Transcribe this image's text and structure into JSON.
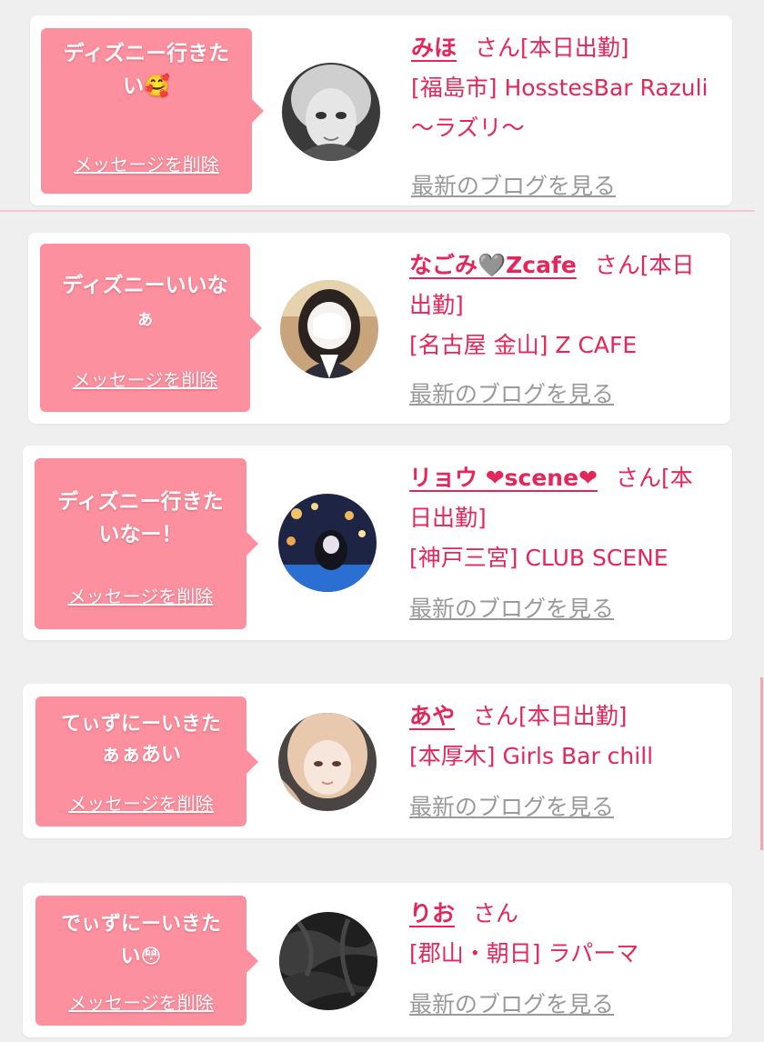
{
  "delete_label": "メッセージを削除",
  "blog_label": "最新のブログを見る",
  "san_label": "さん",
  "cards": [
    {
      "message_line1": "ディズニー行きた",
      "message_line2": "い🥰",
      "name": "みほ",
      "status": "[本日出勤]",
      "shop_line1": "[福島市] HosstesBar Razuli",
      "shop_line2": "〜ラズリ〜",
      "avatar_icon": "avatar-grayscale-girl"
    },
    {
      "message_line1": "ディズニーいいな",
      "message_line2": "ぁ",
      "name": "なごみ🩶Zcafe",
      "status_line1": "[本日",
      "status_line2": "出勤]",
      "shop_line1": "[名古屋 金山] Z CAFE",
      "avatar_icon": "avatar-uniform-girl"
    },
    {
      "message_line1": "ディズニー行きた",
      "message_line2": "いなー！",
      "name": "リョウ ❤scene❤",
      "status_line1": "[本",
      "status_line2": "日出勤]",
      "shop_line1": "[神戸三宮] CLUB SCENE",
      "avatar_icon": "avatar-night-lights"
    },
    {
      "message_line1": "てぃずにーいきた",
      "message_line2": "ぁぁあい",
      "name": "あや",
      "status": "[本日出勤]",
      "shop_line1": "[本厚木] Girls Bar chill",
      "avatar_icon": "avatar-blonde-girl"
    },
    {
      "message_line1": "でぃずにーいきた",
      "message_line2": "い😳",
      "name": "りお",
      "status": "",
      "shop_line1": "[郡山・朝日] ラパーマ",
      "avatar_icon": "avatar-dark-hair"
    }
  ],
  "colors": {
    "accent": "#e5265a",
    "bubble": "#fc909f",
    "link_gray": "#9a9a9a",
    "background": "#efefef"
  }
}
